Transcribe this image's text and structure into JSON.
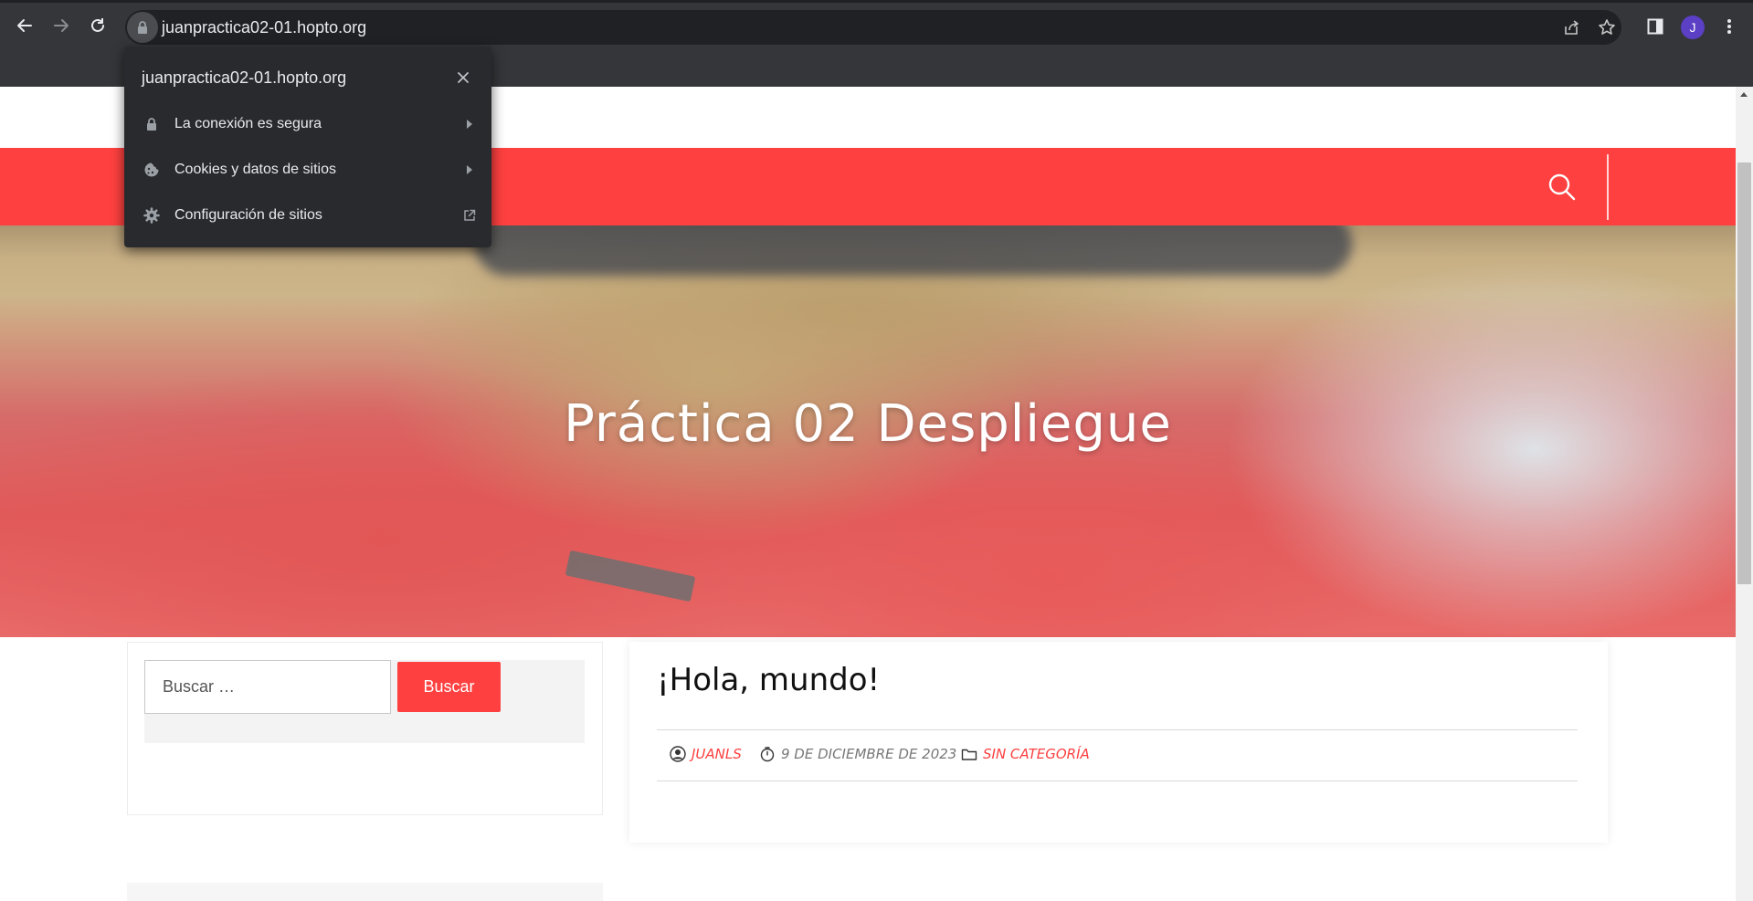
{
  "browser": {
    "url": "juanpractica02-01.hopto.org",
    "profile_initial": "J",
    "icons": [
      "back-arrow",
      "forward-arrow",
      "reload",
      "lock",
      "share",
      "star",
      "side-panel",
      "menu-dots"
    ]
  },
  "site_info_popup": {
    "host": "juanpractica02-01.hopto.org",
    "items": [
      {
        "label": "La conexión es segura",
        "icon": "lock",
        "trailing": "chevron-right"
      },
      {
        "label": "Cookies y datos de sitios",
        "icon": "cookie",
        "trailing": "chevron-right"
      },
      {
        "label": "Configuración de sitios",
        "icon": "gear",
        "trailing": "external-link"
      }
    ]
  },
  "site": {
    "hero_title": "Práctica 02 Despliegue",
    "accent_color": "#fe4040"
  },
  "sidebar": {
    "search_placeholder": "Buscar …",
    "search_button": "Buscar"
  },
  "post": {
    "title": "¡Hola, mundo!",
    "author": "JUANLS",
    "date": "9 DE DICIEMBRE DE 2023",
    "category": "SIN CATEGORÍA"
  }
}
